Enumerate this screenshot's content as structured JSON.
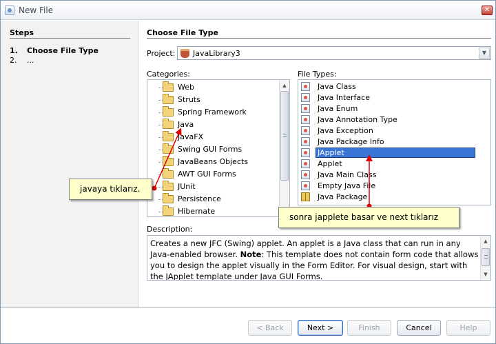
{
  "window": {
    "title": "New File"
  },
  "steps": {
    "title": "Steps",
    "items": [
      {
        "num": "1.",
        "label": "Choose File Type"
      },
      {
        "num": "2.",
        "label": "..."
      }
    ]
  },
  "main": {
    "title": "Choose File Type",
    "project_label": "Project:",
    "project_value": "JavaLibrary3",
    "categories_label": "Categories:",
    "file_types_label": "File Types:",
    "categories": [
      "Web",
      "Struts",
      "Spring Framework",
      "Java",
      "JavaFX",
      "Swing GUI Forms",
      "JavaBeans Objects",
      "AWT GUI Forms",
      "JUnit",
      "Persistence",
      "Hibernate"
    ],
    "file_types": [
      "Java Class",
      "Java Interface",
      "Java Enum",
      "Java Annotation Type",
      "Java Exception",
      "Java Package Info",
      "JApplet",
      "Applet",
      "Java Main Class",
      "Empty Java File",
      "Java Package"
    ],
    "selected_file_type": "JApplet",
    "description_label": "Description:",
    "description_part1": "Creates a new JFC (Swing) applet. An applet is a Java class that can run in any Java-enabled browser. ",
    "description_note": "Note",
    "description_part2": ": This template does not contain form code that allows you to design the applet visually in the Form Editor. For visual design, start with the JApplet template under Java GUI Forms."
  },
  "annotations": {
    "java_callout": "javaya tıklarız.",
    "applet_callout": "sonra japplete basar ve next tıklarız",
    "arrow_color": "#e00000"
  },
  "buttons": {
    "back": "< Back",
    "next": "Next >",
    "finish": "Finish",
    "cancel": "Cancel",
    "help": "Help"
  }
}
